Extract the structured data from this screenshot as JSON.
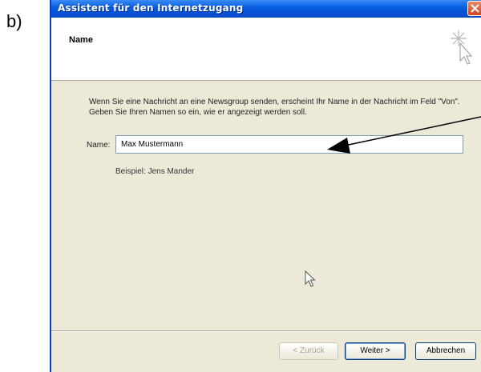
{
  "figure_label": "b)",
  "window": {
    "title": "Assistent für den Internetzugang"
  },
  "header": {
    "title": "Name"
  },
  "body": {
    "description": "Wenn Sie eine Nachricht an eine Newsgroup senden, erscheint Ihr Name in der Nachricht im Feld \"Von\". Geben Sie Ihren Namen so ein, wie er angezeigt werden soll.",
    "name_label": "Name:",
    "name_value": "Max Mustermann",
    "example": "Beispiel: Jens Mander"
  },
  "buttons": {
    "back": "< Zurück",
    "next": "Weiter >",
    "cancel": "Abbrechen"
  },
  "colors": {
    "titlebar": "#0a5fe0",
    "dialog_bg": "#ece9d8",
    "close_button": "#d4461e"
  },
  "icons": [
    "close-icon",
    "wizard-sparkle-cursor-icon",
    "mouse-cursor-icon",
    "annotation-arrow"
  ]
}
